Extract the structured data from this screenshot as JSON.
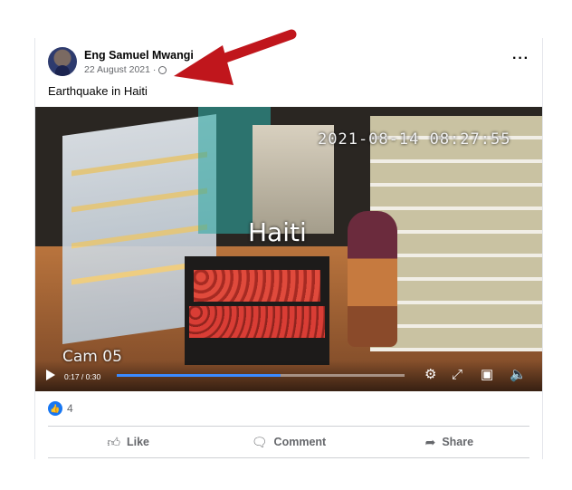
{
  "post": {
    "author": "Eng Samuel Mwangi",
    "date": "22 August 2021 ·",
    "caption": "Earthquake in Haiti",
    "more_icon": "more-options-icon"
  },
  "video": {
    "timestamp_overlay": "2021-08-14 08:27:55",
    "sign_overlay": "Haiti",
    "camera_label": "Cam 05",
    "time": "0:17 / 0:30",
    "progress": 0.57
  },
  "reactions": {
    "count": "4",
    "badge_icon": "thumbs-up-icon"
  },
  "actions": {
    "like": "Like",
    "comment": "Comment",
    "share": "Share"
  },
  "colors": {
    "brand": "#1877f2",
    "arrow": "#c0161c"
  }
}
